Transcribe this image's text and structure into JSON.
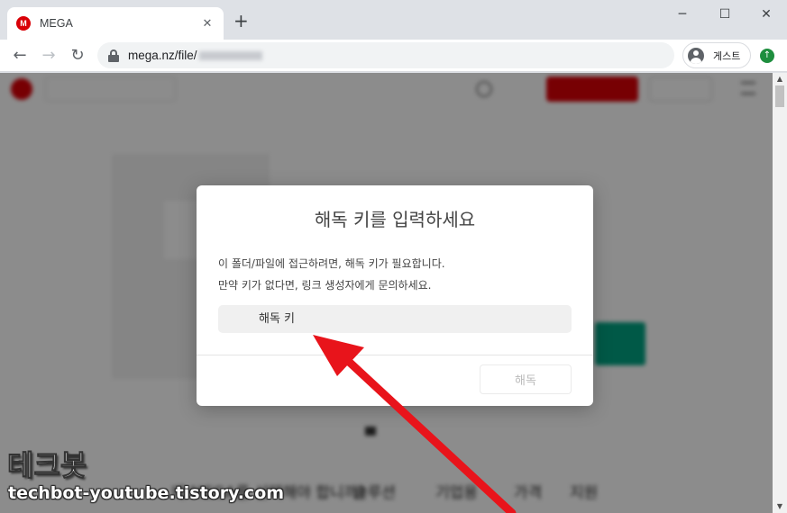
{
  "browser": {
    "tab_title": "MEGA",
    "favicon_letter": "M",
    "tab_close": "✕",
    "new_tab": "+",
    "minimize": "─",
    "maximize": "☐",
    "close": "✕",
    "url": "mega.nz/file/",
    "guest_label": "게스트",
    "back": "←",
    "forward": "→",
    "reload": "↻",
    "update": "↑"
  },
  "dialog": {
    "title": "해독 키를 입력하세요",
    "message_line1": "이 폴더/파일에 접근하려면, 해독 키가 필요합니다.",
    "message_line2": "만약 키가 없다면, 링크 생성자에게 문의하세요.",
    "key_placeholder": "해독 키",
    "decrypt_label": "해독"
  },
  "background_page": {
    "logo_letter": "M",
    "nav_items": [
      "솔루션",
      "기업용",
      "가격",
      "지원"
    ],
    "bottom_text": "왜 MEGA를 선택해야 합니까?"
  },
  "watermark": {
    "title": "테크봇",
    "url": "techbot-youtube.tistory.com"
  },
  "colors": {
    "mega_red": "#d90007",
    "mega_green": "#00a382",
    "annotation_arrow": "#e8141b"
  }
}
